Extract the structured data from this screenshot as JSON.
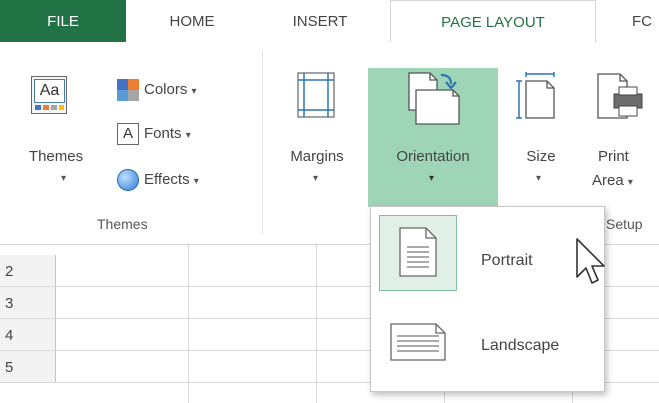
{
  "tabs": [
    {
      "id": "file",
      "label": "FILE"
    },
    {
      "id": "home",
      "label": "HOME"
    },
    {
      "id": "insert",
      "label": "INSERT"
    },
    {
      "id": "page_layout",
      "label": "PAGE LAYOUT"
    },
    {
      "id": "formulas",
      "label": "FC"
    }
  ],
  "ribbon": {
    "themes_button": {
      "label": "Themes",
      "caret": "▾",
      "icon": "themes-icon"
    },
    "colors_button": {
      "label": "Colors",
      "caret": "▾",
      "icon": "colors-icon"
    },
    "fonts_button": {
      "label": "Fonts",
      "caret": "▾",
      "icon": "fonts-icon",
      "glyph": "A"
    },
    "effects_button": {
      "label": "Effects",
      "caret": "▾",
      "icon": "effects-icon"
    },
    "themes_group_label": "Themes",
    "margins_button": {
      "label": "Margins",
      "caret": "▾",
      "icon": "margins-icon"
    },
    "orientation_button": {
      "label": "Orientation",
      "caret": "▾",
      "icon": "orientation-icon"
    },
    "size_button": {
      "label": "Size",
      "caret": "▾",
      "icon": "size-icon"
    },
    "print_area_button": {
      "label_line1": "Print",
      "label_line2": "Area",
      "caret": "▾",
      "icon": "print-area-icon"
    },
    "setup_group_label": "Setup",
    "themes_icon_text": "Aa"
  },
  "rows": [
    "2",
    "3",
    "4",
    "5"
  ],
  "orientation_menu": {
    "items": [
      {
        "label": "Portrait",
        "icon": "portrait-icon",
        "highlighted": true
      },
      {
        "label": "Landscape",
        "icon": "landscape-icon",
        "highlighted": false
      }
    ]
  },
  "colors": {
    "file_tab": "#217346",
    "accent": "#217346",
    "orientation_pressed": "#9fd5b7",
    "menu_highlight": "#e1f0e7"
  }
}
